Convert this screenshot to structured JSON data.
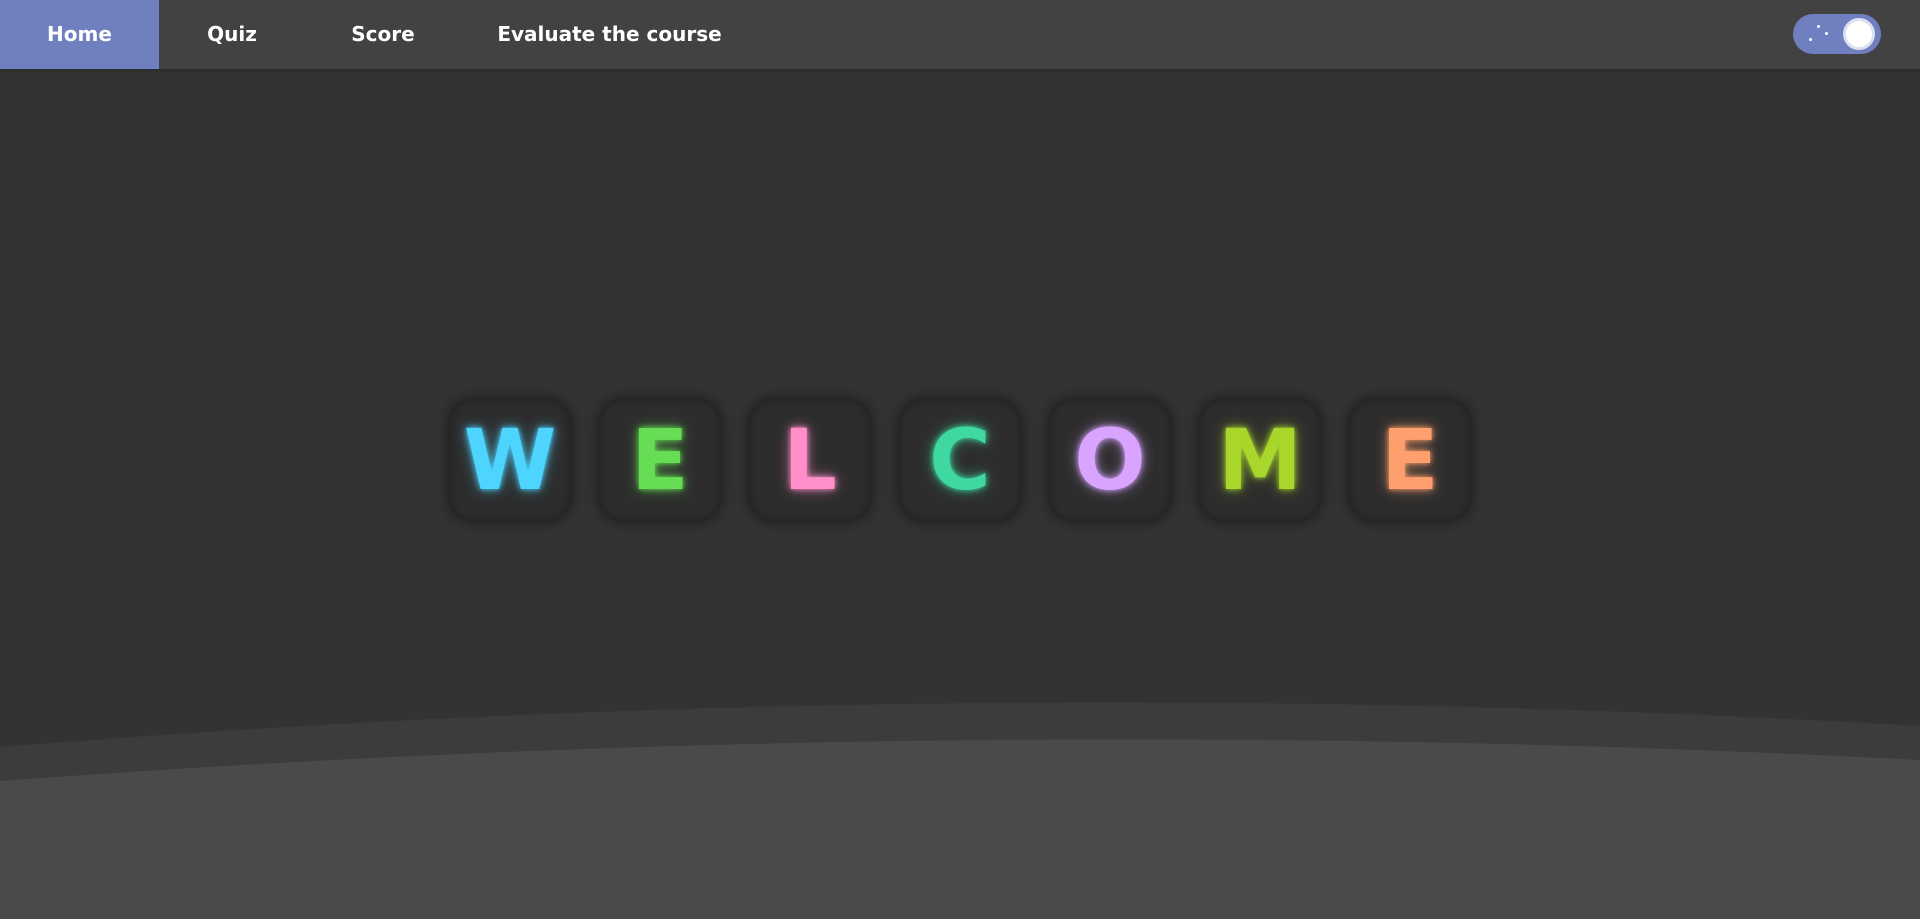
{
  "nav": {
    "items": [
      {
        "label": "Home",
        "active": true
      },
      {
        "label": "Quiz",
        "active": false
      },
      {
        "label": "Score",
        "active": false
      },
      {
        "label": "Evaluate the course",
        "active": false
      }
    ]
  },
  "theme_toggle": {
    "icon": "moon-toggle-icon",
    "state": "dark"
  },
  "welcome": {
    "letters": [
      {
        "char": "W",
        "color": "#4dd4ff"
      },
      {
        "char": "E",
        "color": "#66dd55"
      },
      {
        "char": "L",
        "color": "#ff8ec9"
      },
      {
        "char": "C",
        "color": "#3ed8a0"
      },
      {
        "char": "O",
        "color": "#d8a4ff"
      },
      {
        "char": "M",
        "color": "#a8d62a"
      },
      {
        "char": "E",
        "color": "#ff9f6e"
      }
    ]
  },
  "colors": {
    "background": "#333333",
    "navbar": "#424242",
    "accent": "#6f7fc0",
    "wave_back": "#3c3c3c",
    "wave_front": "#4a4a4a"
  }
}
